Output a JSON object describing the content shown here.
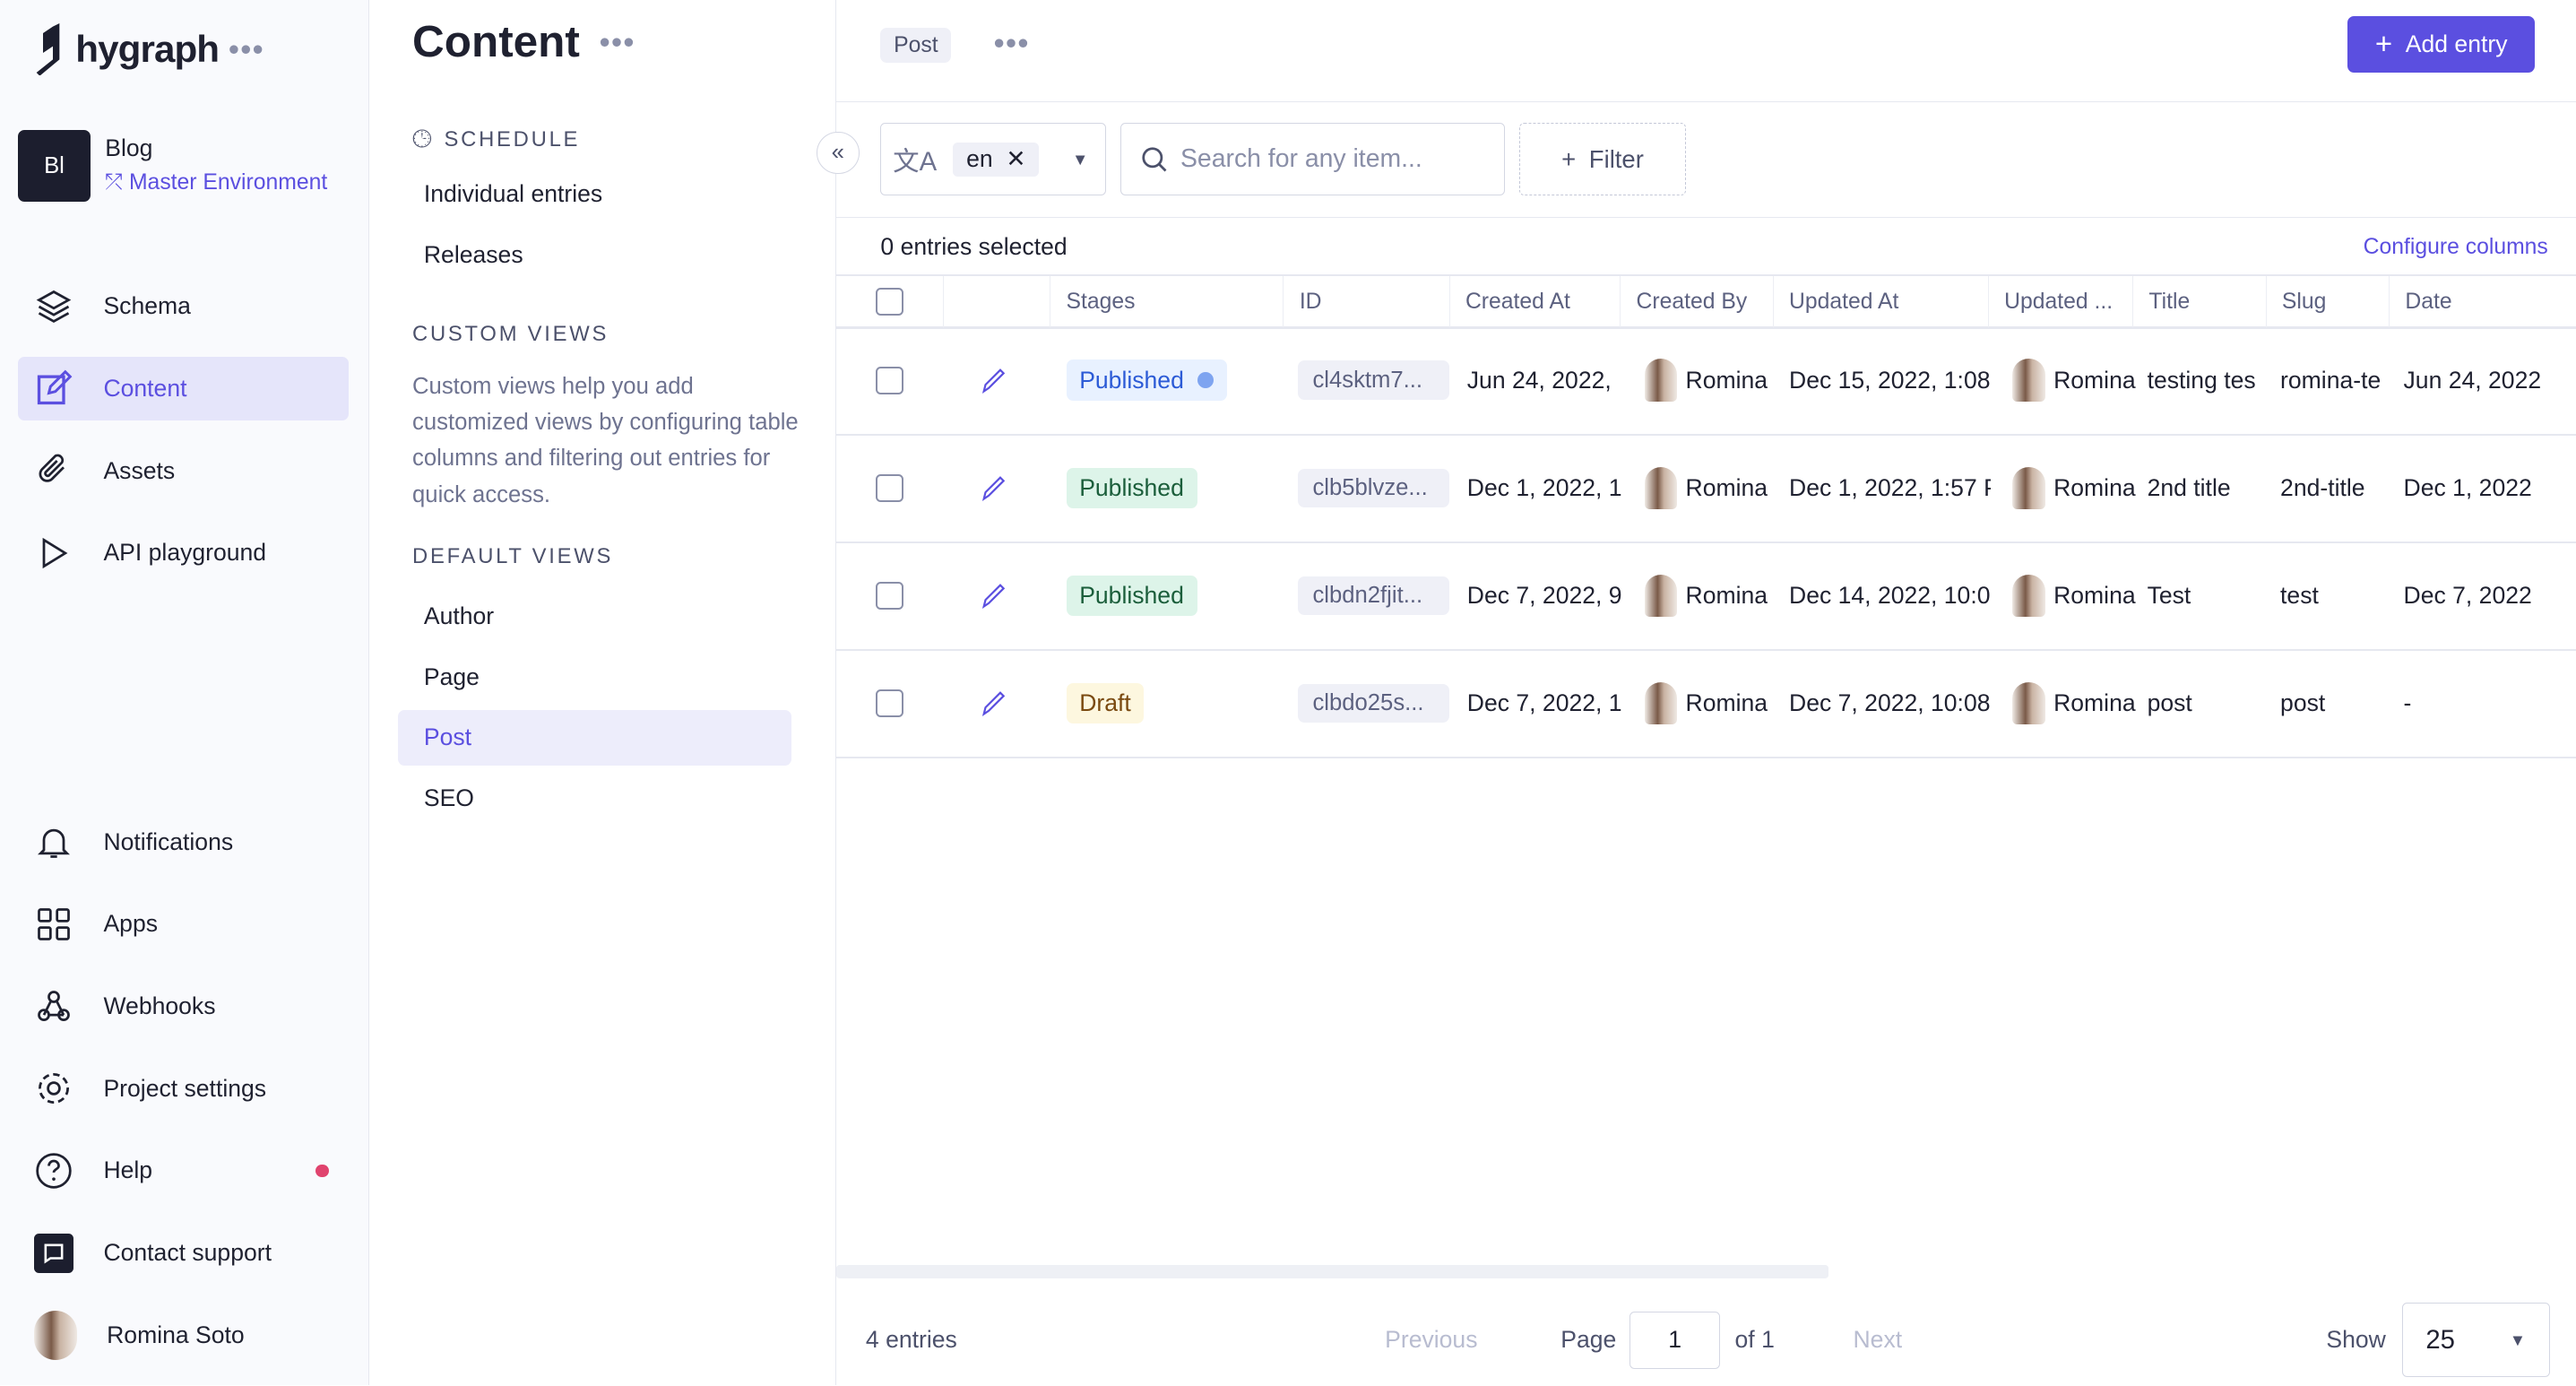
{
  "app": {
    "brand": "hygraph",
    "project": "Blog",
    "project_initials": "Bl",
    "environment": "Master Environment"
  },
  "nav": {
    "top": [
      {
        "label": "Schema",
        "icon": "layers-icon"
      },
      {
        "label": "Content",
        "icon": "edit-icon",
        "active": true
      },
      {
        "label": "Assets",
        "icon": "paperclip-icon"
      },
      {
        "label": "API playground",
        "icon": "play-icon"
      }
    ],
    "bottom": [
      {
        "label": "Notifications",
        "icon": "bell-icon"
      },
      {
        "label": "Apps",
        "icon": "grid-icon"
      },
      {
        "label": "Webhooks",
        "icon": "webhook-icon"
      },
      {
        "label": "Project settings",
        "icon": "gear-icon"
      },
      {
        "label": "Help",
        "icon": "help-icon"
      },
      {
        "label": "Contact support",
        "icon": "chat-icon"
      },
      {
        "label": "Romina Soto",
        "icon": "avatar"
      }
    ]
  },
  "sub": {
    "title": "Content",
    "schedule_heading": "SCHEDULE",
    "schedule_items": [
      "Individual entries",
      "Releases"
    ],
    "custom_heading": "CUSTOM VIEWS",
    "custom_desc": "Custom views help you add customized views by configuring table columns and filtering out entries for quick access.",
    "default_heading": "DEFAULT VIEWS",
    "default_items": [
      "Author",
      "Page",
      "Post",
      "SEO"
    ],
    "active": "Post"
  },
  "main": {
    "model_tag": "Post",
    "add_entry": "Add entry",
    "locale": "en",
    "search_placeholder": "Search for any item...",
    "filter": "Filter",
    "selected": "0 entries selected",
    "configure": "Configure columns",
    "columns": [
      "Stages",
      "ID",
      "Created At",
      "Created By",
      "Updated At",
      "Updated ...",
      "Title",
      "Slug",
      "Date"
    ],
    "rows": [
      {
        "stage": "Published",
        "stage_kind": "published-changed",
        "id": "cl4sktm7...",
        "created_at": "Jun 24, 2022,",
        "created_by": "Romina",
        "updated_at": "Dec 15, 2022, 1:08",
        "updated_by": "Romina",
        "title": "testing tes",
        "slug": "romina-te",
        "date": "Jun 24, 2022"
      },
      {
        "stage": "Published",
        "stage_kind": "published",
        "id": "clb5blvze...",
        "created_at": "Dec 1, 2022, 1:",
        "created_by": "Romina",
        "updated_at": "Dec 1, 2022, 1:57 P",
        "updated_by": "Romina",
        "title": "2nd title",
        "slug": "2nd-title",
        "date": "Dec 1, 2022"
      },
      {
        "stage": "Published",
        "stage_kind": "published",
        "id": "clbdn2fjit...",
        "created_at": "Dec 7, 2022, 9",
        "created_by": "Romina",
        "updated_at": "Dec 14, 2022, 10:0",
        "updated_by": "Romina",
        "title": "Test",
        "slug": "test",
        "date": "Dec 7, 2022"
      },
      {
        "stage": "Draft",
        "stage_kind": "draft",
        "id": "clbdo25s...",
        "created_at": "Dec 7, 2022, 1",
        "created_by": "Romina",
        "updated_at": "Dec 7, 2022, 10:08",
        "updated_by": "Romina",
        "title": "post",
        "slug": "post",
        "date": "-"
      }
    ],
    "footer": {
      "count": "4 entries",
      "previous": "Previous",
      "page_label": "Page",
      "page": "1",
      "of": "of 1",
      "next": "Next",
      "show": "Show",
      "page_size": "25"
    }
  },
  "colors": {
    "accent": "#5b4fe0",
    "published_bg": "#ddf4e9",
    "published_fg": "#1b5e3b",
    "published_changed_bg": "#e8f1ff",
    "published_changed_fg": "#2c5bd6",
    "draft_bg": "#fdf7df",
    "draft_fg": "#7a4a10"
  }
}
